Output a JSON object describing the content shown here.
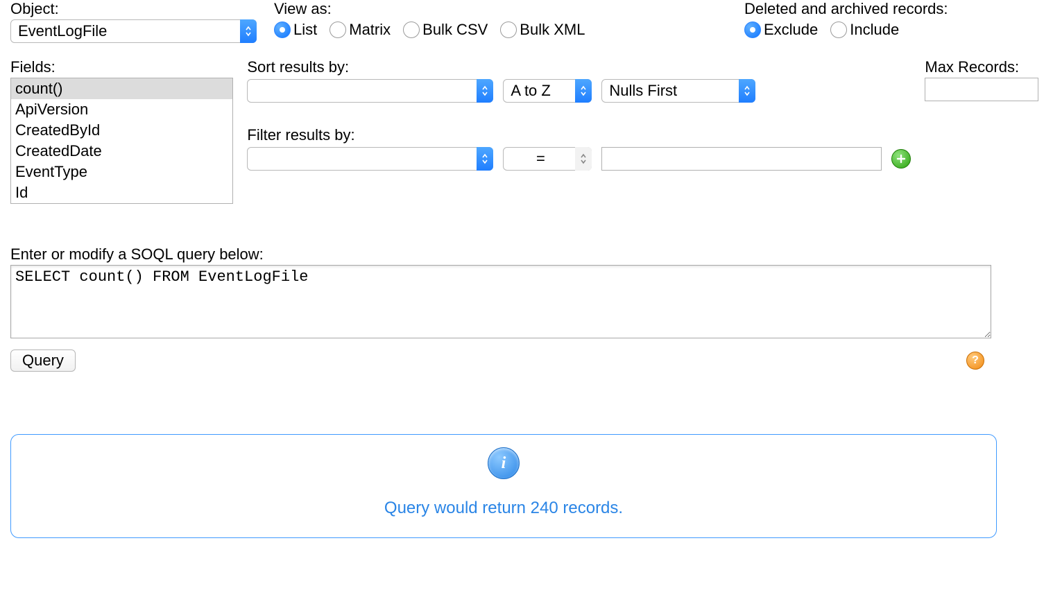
{
  "object": {
    "label": "Object:",
    "value": "EventLogFile"
  },
  "view_as": {
    "label": "View as:",
    "options": [
      "List",
      "Matrix",
      "Bulk CSV",
      "Bulk XML"
    ],
    "selected": "List"
  },
  "deleted_archived": {
    "label": "Deleted and archived records:",
    "options": [
      "Exclude",
      "Include"
    ],
    "selected": "Exclude"
  },
  "fields": {
    "label": "Fields:",
    "items": [
      "count()",
      "ApiVersion",
      "CreatedById",
      "CreatedDate",
      "EventType",
      "Id"
    ],
    "selected": "count()"
  },
  "sort": {
    "label": "Sort results by:",
    "field": "",
    "direction": "A to Z",
    "nulls": "Nulls First"
  },
  "max_records": {
    "label": "Max Records:",
    "value": ""
  },
  "filter": {
    "label": "Filter results by:",
    "field": "",
    "operator": "=",
    "value": ""
  },
  "soql": {
    "label": "Enter or modify a SOQL query below:",
    "value": "SELECT count() FROM EventLogFile",
    "query_button": "Query"
  },
  "result": {
    "message": "Query would return 240 records."
  }
}
